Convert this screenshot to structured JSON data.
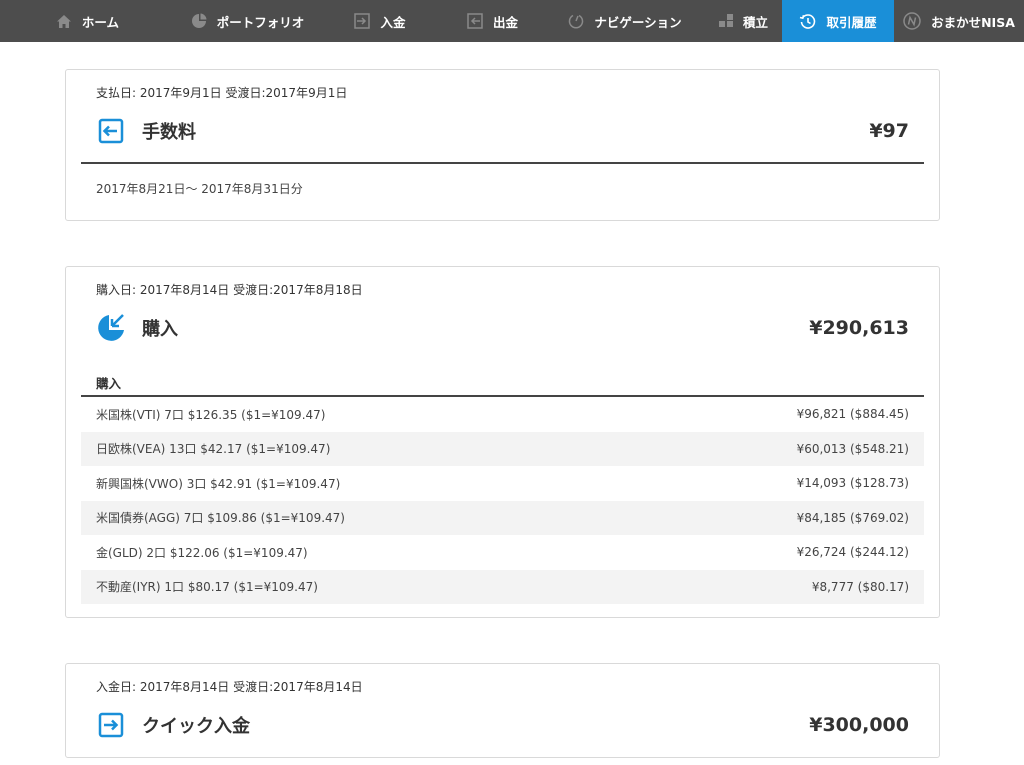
{
  "nav": {
    "items": [
      {
        "label": "ホーム",
        "icon": "home-icon"
      },
      {
        "label": "ポートフォリオ",
        "icon": "pie-chart-icon"
      },
      {
        "label": "入金",
        "icon": "deposit-icon"
      },
      {
        "label": "出金",
        "icon": "withdraw-icon"
      },
      {
        "label": "ナビゲーション",
        "icon": "navigation-icon"
      },
      {
        "label": "積立",
        "icon": "accumulate-icon"
      },
      {
        "label": "取引履歴",
        "icon": "history-icon"
      },
      {
        "label": "おまかせNISA",
        "icon": "nisa-icon"
      }
    ],
    "active_index": 6,
    "active_color": "#1a8fd8"
  },
  "transactions": [
    {
      "date_text": "支払日: 2017年9月1日 受渡日:2017年9月1日",
      "title": "手数料",
      "icon": "fee-icon",
      "amount": "¥97",
      "note": "2017年8月21日～ 2017年8月31日分"
    },
    {
      "date_text": "購入日: 2017年8月14日 受渡日:2017年8月18日",
      "title": "購入",
      "icon": "purchase-pie-icon",
      "amount": "¥290,613",
      "section_label": "購入",
      "rows": [
        {
          "desc": "米国株(VTI) 7口 $126.35 ($1=¥109.47)",
          "amount": "¥96,821 ($884.45)"
        },
        {
          "desc": "日欧株(VEA) 13口 $42.17 ($1=¥109.47)",
          "amount": "¥60,013 ($548.21)"
        },
        {
          "desc": "新興国株(VWO) 3口 $42.91 ($1=¥109.47)",
          "amount": "¥14,093 ($128.73)"
        },
        {
          "desc": "米国債券(AGG) 7口 $109.86 ($1=¥109.47)",
          "amount": "¥84,185 ($769.02)"
        },
        {
          "desc": "金(GLD) 2口 $122.06 ($1=¥109.47)",
          "amount": "¥26,724 ($244.12)"
        },
        {
          "desc": "不動産(IYR) 1口 $80.17 ($1=¥109.47)",
          "amount": "¥8,777 ($80.17)"
        }
      ]
    },
    {
      "date_text": "入金日: 2017年8月14日 受渡日:2017年8月14日",
      "title": "クイック入金",
      "icon": "deposit-icon",
      "amount": "¥300,000"
    }
  ],
  "colors": {
    "accent": "#1a8fd8",
    "nav_bg": "#4d4d4d"
  }
}
